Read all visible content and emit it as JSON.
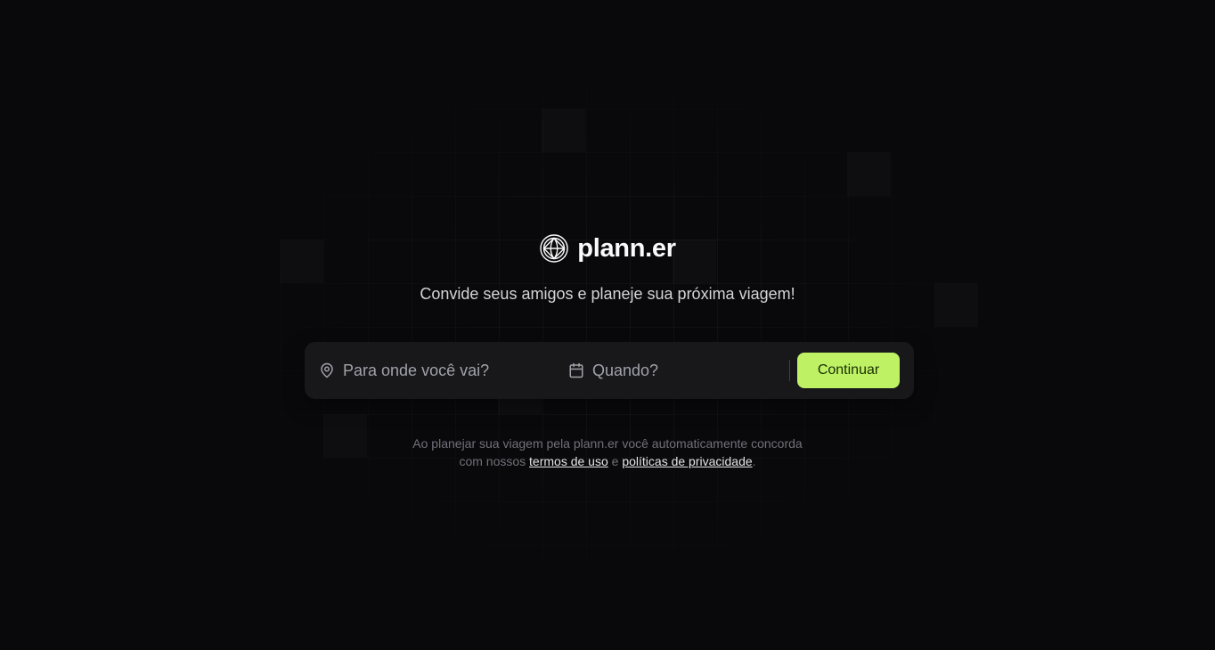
{
  "brand": {
    "name": "plann.er",
    "icon": "globe-icon"
  },
  "hero": {
    "tagline": "Convide seus amigos e planeje sua próxima viagem!"
  },
  "form": {
    "destination": {
      "icon": "map-pin-icon",
      "placeholder": "Para onde você vai?",
      "value": ""
    },
    "date": {
      "icon": "calendar-icon",
      "placeholder": "Quando?",
      "value": ""
    },
    "submit_label": "Continuar"
  },
  "legal": {
    "line1": "Ao planejar sua viagem pela plann.er você automaticamente concorda",
    "prefix": "com nossos",
    "terms_label": "termos de uso",
    "conjunction": "e",
    "privacy_label": "políticas de privacidade",
    "suffix": "."
  },
  "colors": {
    "background": "#09090b",
    "surface": "#18181b",
    "accent": "#bef264",
    "accent_text": "#1a2e05"
  }
}
